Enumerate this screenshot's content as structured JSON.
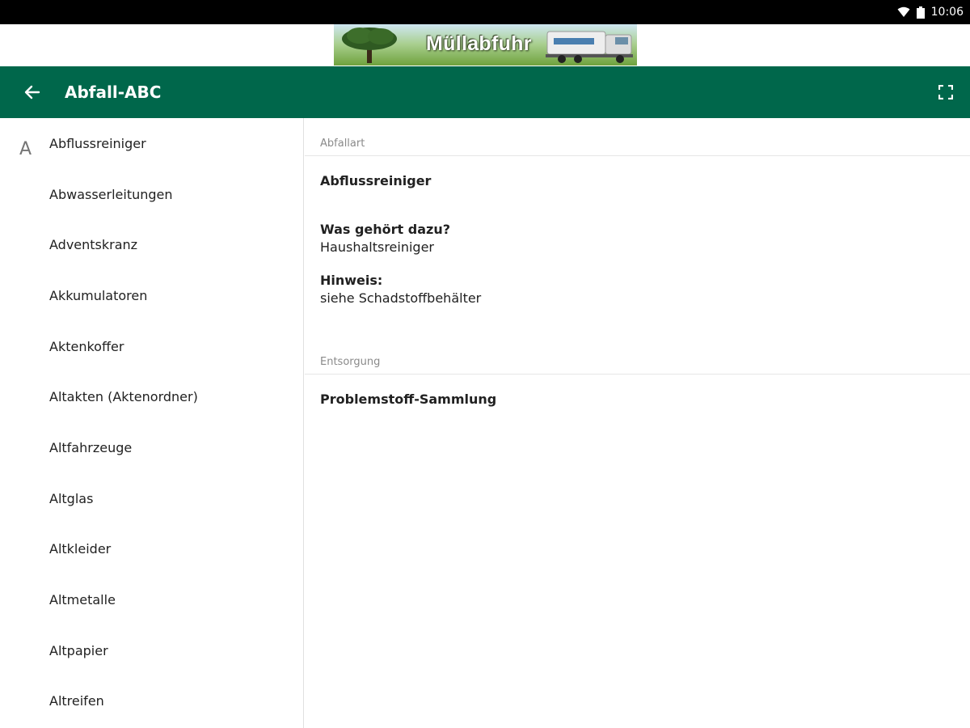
{
  "status_bar": {
    "time": "10:06"
  },
  "banner": {
    "title": "Müllabfuhr"
  },
  "toolbar": {
    "title": "Abfall-ABC"
  },
  "list": {
    "section_letter": "A",
    "items": [
      "Abflussreiniger",
      "Abwasserleitungen",
      "Adventskranz",
      "Akkumulatoren",
      "Aktenkoffer",
      "Altakten (Aktenordner)",
      "Altfahrzeuge",
      "Altglas",
      "Altkleider",
      "Altmetalle",
      "Altpapier",
      "Altreifen"
    ]
  },
  "detail": {
    "abfallart_header": "Abfallart",
    "waste_name": "Abflussreiniger",
    "belongs_label": "Was gehört dazu?",
    "belongs_value": "Haushaltsreiniger",
    "hint_label": "Hinweis:",
    "hint_value": "siehe Schadstoffbehälter",
    "disposal_header": "Entsorgung",
    "disposal_value": "Problemstoff-Sammlung"
  },
  "colors": {
    "toolbar": "#00674b",
    "status_bar": "#000000"
  }
}
